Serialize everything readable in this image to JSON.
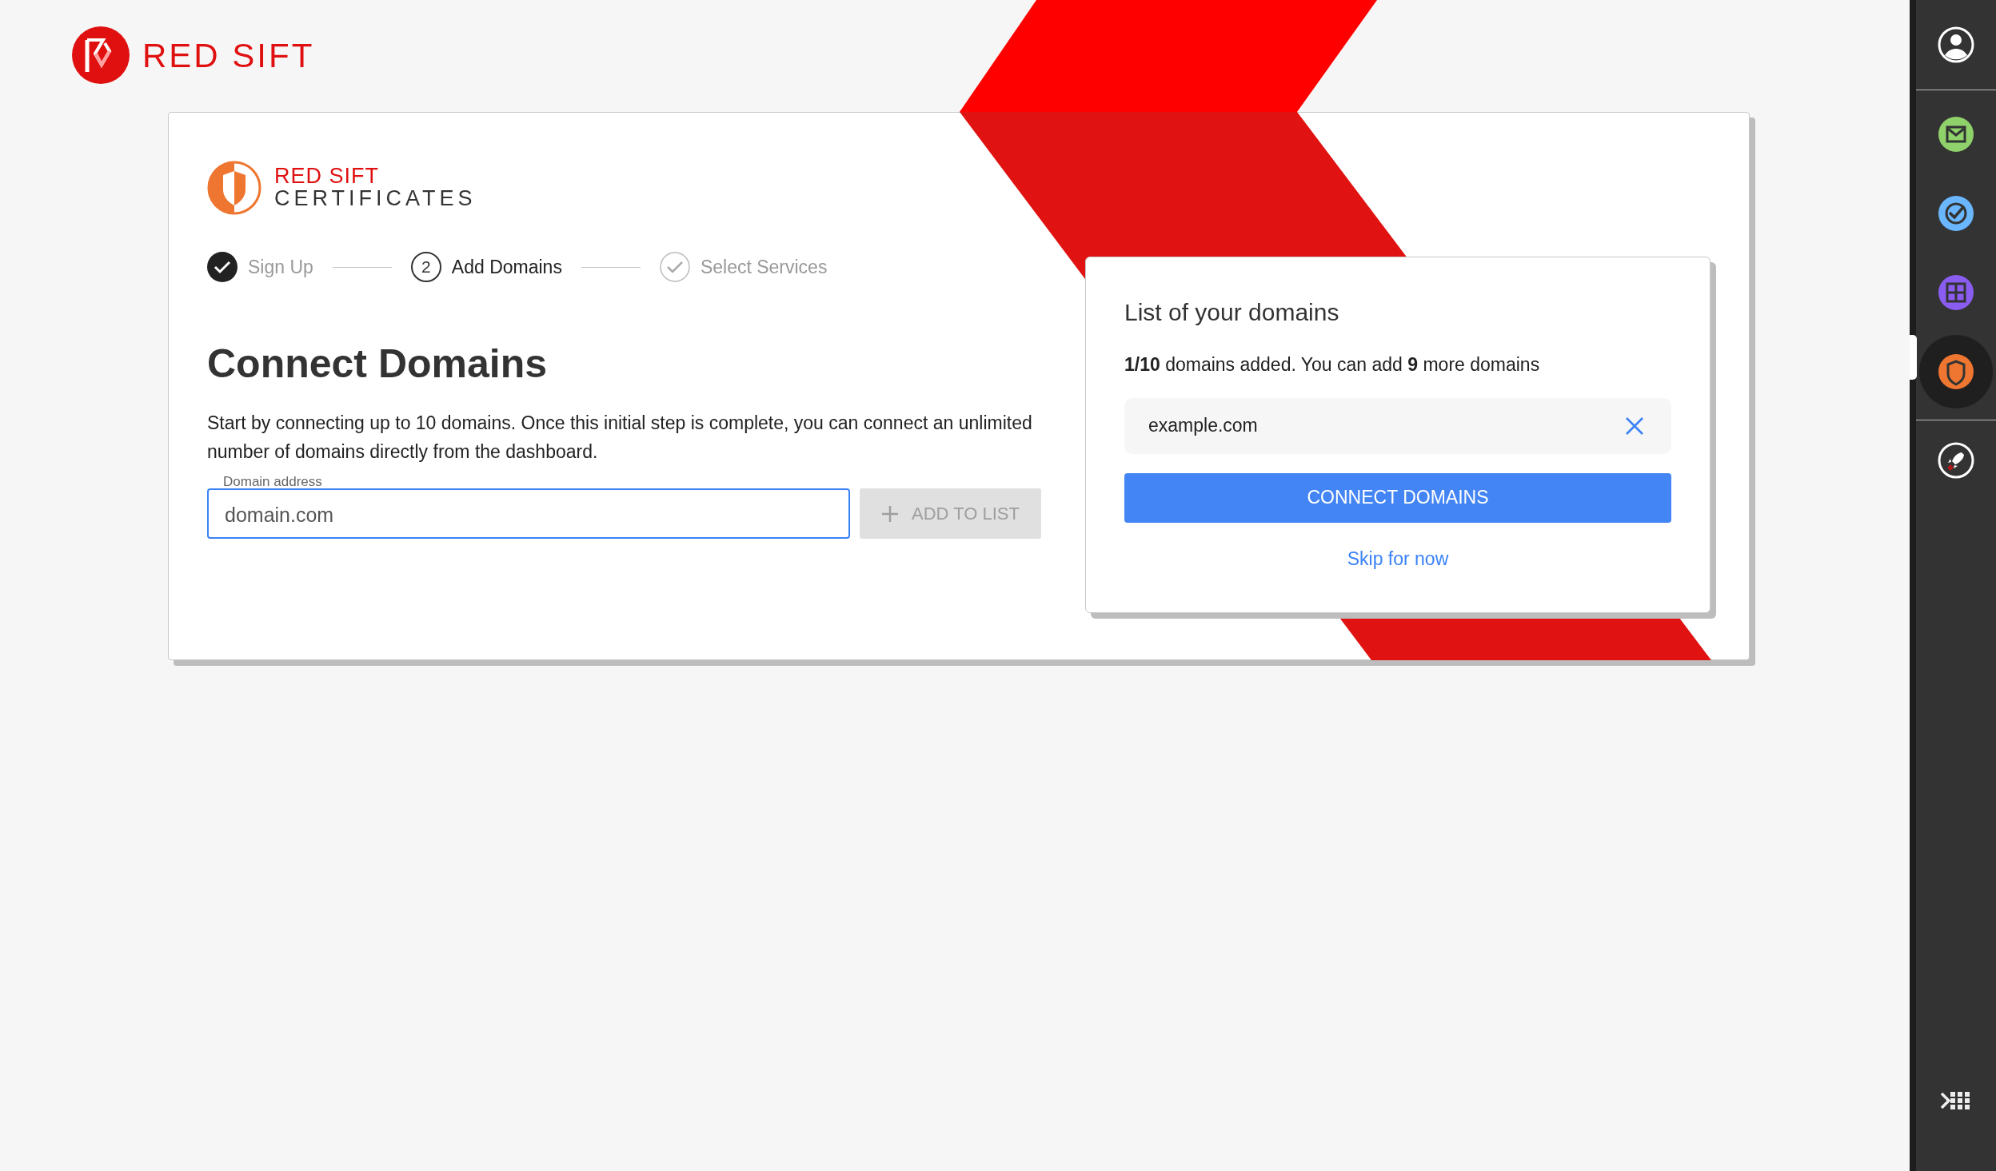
{
  "brand": {
    "name": "RED SIFT"
  },
  "product": {
    "brand": "RED SIFT",
    "name": "CERTIFICATES"
  },
  "steps": [
    {
      "label": "Sign Up",
      "completed": true,
      "selected": false
    },
    {
      "label": "Add Domains",
      "completed": false,
      "selected": true,
      "marker": "2"
    },
    {
      "label": "Select Services",
      "completed": false,
      "selected": false
    }
  ],
  "heading": "Connect Domains",
  "description": "Start by connecting up to 10 domains. Once this initial step is complete, you can connect an unlimited number of domains directly from the dashboard.",
  "domain_field": {
    "label": "Domain address",
    "value": "domain.com",
    "focused": true
  },
  "add_button": {
    "label": "ADD TO LIST",
    "disabled": true
  },
  "domain_list": {
    "title": "List of your domains",
    "summary": "**1/10** domains added. You can add **9** more domains",
    "items": [
      {
        "domain": "example.com"
      }
    ],
    "connect_button": "CONNECT DOMAINS",
    "skip_link": "Skip for now"
  },
  "sidebar": {
    "products": [
      {
        "kind": "mail",
        "color": "#8fd16a",
        "selected": false
      },
      {
        "kind": "check",
        "color": "#6ab7ff",
        "selected": false
      },
      {
        "kind": "grid",
        "color": "#8a5cf0",
        "selected": false
      },
      {
        "kind": "shield",
        "color": "#ee7630",
        "selected": true
      }
    ]
  }
}
